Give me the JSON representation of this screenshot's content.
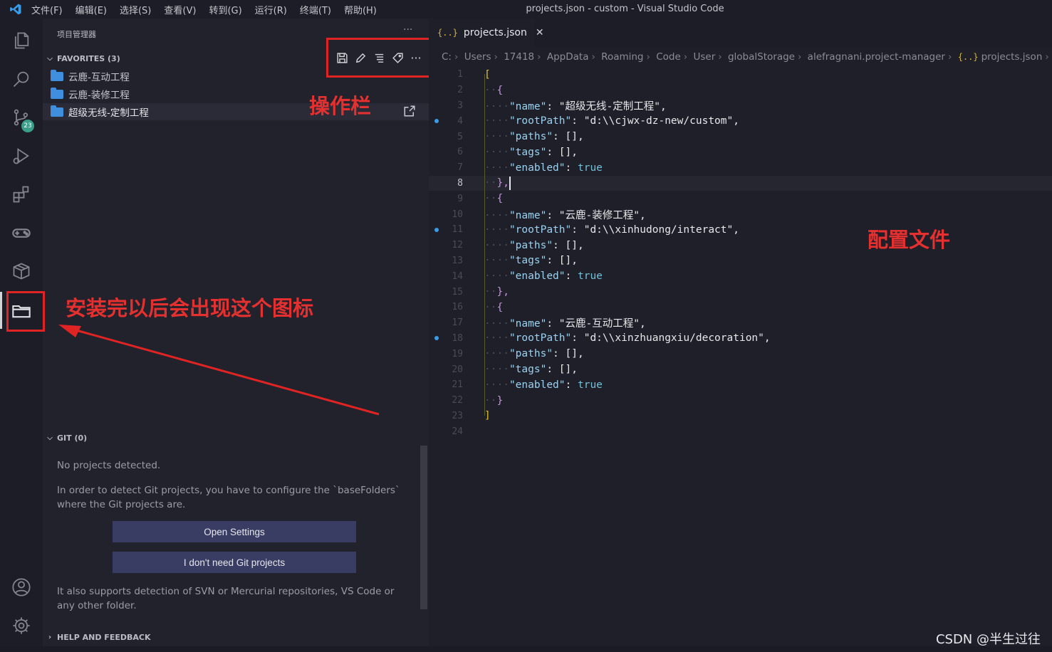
{
  "titlebar": {
    "menus": [
      "文件(F)",
      "编辑(E)",
      "选择(S)",
      "查看(V)",
      "转到(G)",
      "运行(R)",
      "终端(T)",
      "帮助(H)"
    ],
    "window_title": "projects.json - custom - Visual Studio Code"
  },
  "activitybar": {
    "git_badge": "23"
  },
  "sidebar": {
    "title": "项目管理器",
    "more": "···",
    "favorites": {
      "header": "FAVORITES (3)",
      "items": [
        "云鹿-互动工程",
        "云鹿-装修工程",
        "超级无线-定制工程"
      ]
    },
    "git": {
      "header": "GIT (0)",
      "no_projects": "No projects detected.",
      "instructions": "In order to detect Git projects, you have to configure the `baseFolders` where the Git projects are.",
      "open_settings": "Open Settings",
      "dont_need": "I don't need Git projects",
      "also_supports": "It also supports detection of SVN or Mercurial repositories, VS Code or any other folder."
    },
    "help": {
      "header": "HELP AND FEEDBACK"
    }
  },
  "editor": {
    "tab": {
      "icon": "{..}",
      "label": "projects.json",
      "close": "✕"
    },
    "breadcrumb": [
      "C:",
      "Users",
      "17418",
      "AppData",
      "Roaming",
      "Code",
      "User",
      "globalStorage",
      "alefragnani.project-manager",
      "projects.json",
      "..."
    ],
    "breadcrumb_icon": "{..}",
    "current_line": 8,
    "line_numbers": [
      "1",
      "2",
      "3",
      "4",
      "5",
      "6",
      "7",
      "8",
      "9",
      "10",
      "11",
      "12",
      "13",
      "14",
      "15",
      "16",
      "17",
      "18",
      "19",
      "20",
      "21",
      "22",
      "23",
      "24"
    ],
    "code": {
      "l1": "[",
      "l2": "{",
      "name1": "\"超级无线-定制工程\"",
      "path1": "\"d:\\\\cjwx-dz-new/custom\"",
      "l8": "},",
      "l9": "{",
      "name2": "\"云鹿-装修工程\"",
      "path2": "\"d:\\\\xinhudong/interact\"",
      "l15": "},",
      "l16": "{",
      "name3": "\"云鹿-互动工程\"",
      "path3": "\"d:\\\\xinzhuangxiu/decoration\"",
      "l22": "}",
      "l23": "]",
      "key_name": "\"name\"",
      "key_root": "\"rootPath\"",
      "key_paths": "\"paths\"",
      "key_tags": "\"tags\"",
      "key_enabled": "\"enabled\"",
      "empty": "[]",
      "true": "true"
    }
  },
  "annotations": {
    "toolbar": "操作栏",
    "config": "配置文件",
    "installed": "安装完以后会出现这个图标"
  },
  "watermark": "CSDN @半生过往"
}
